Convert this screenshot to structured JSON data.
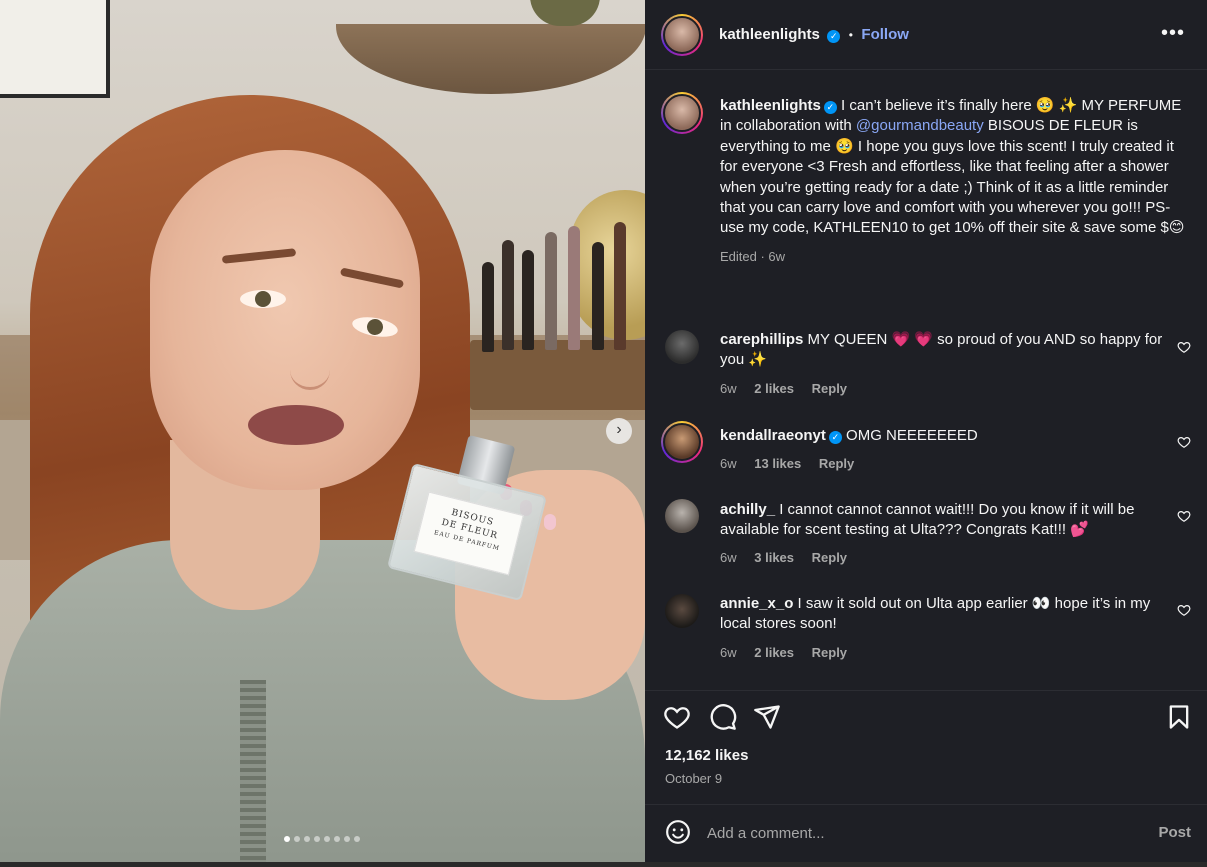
{
  "post": {
    "author": "kathleenlights",
    "follow_label": "Follow",
    "dot_separator": "•",
    "more_label": "•••",
    "caption": {
      "part1": "I can’t believe it’s finally here 🥹 ✨ MY PERFUME in collaboration with ",
      "mention": "@gourmandbeauty",
      "part2": " BISOUS DE FLEUR is everything to me 🥹 I hope you guys love this scent! I truly created it for everyone <3 Fresh and effortless, like that feeling after a shower when you’re getting ready for a date ;) Think of it as a little reminder that you can carry love and comfort with you wherever you go!!! PS- use my code, KATHLEEN10 to get 10% off their site & save some $😊"
    },
    "caption_meta": "Edited · 6w",
    "likes": "12,162 likes",
    "date": "October 9"
  },
  "product": {
    "line1": "BISOUS",
    "line2": "DE FLEUR",
    "line3": "EAU DE PARFUM"
  },
  "comments": [
    {
      "user": "carephillips",
      "text": "MY QUEEN 💗 💗 so proud of you AND so happy for you ✨",
      "age": "6w",
      "likes": "2 likes",
      "reply": "Reply",
      "verified": false
    },
    {
      "user": "kendallraeonyt",
      "text": "OMG NEEEEEEED",
      "age": "6w",
      "likes": "13 likes",
      "reply": "Reply",
      "verified": true
    },
    {
      "user": "achilly_",
      "text": "I cannot cannot cannot wait!!! Do you know if it will be available for scent testing at Ulta??? Congrats Kat!!! 💕",
      "age": "6w",
      "likes": "3 likes",
      "reply": "Reply",
      "verified": false
    },
    {
      "user": "annie_x_o",
      "text": "I saw it sold out on Ulta app earlier 👀 hope it’s in my local stores soon!",
      "age": "6w",
      "likes": "2 likes",
      "reply": "Reply",
      "verified": false
    }
  ],
  "comment_box": {
    "placeholder": "Add a comment...",
    "post_label": "Post"
  },
  "carousel": {
    "count": 8,
    "active": 1,
    "next_label": "›"
  },
  "icons": [
    "heart-icon",
    "comment-icon",
    "share-icon",
    "bookmark-icon",
    "emoji-icon",
    "verified-icon",
    "more-icon"
  ],
  "colors": {
    "panel_bg": "#1e1f25",
    "link": "#8aa7f4",
    "verified": "#0095f6",
    "muted": "#a8a8a8"
  }
}
